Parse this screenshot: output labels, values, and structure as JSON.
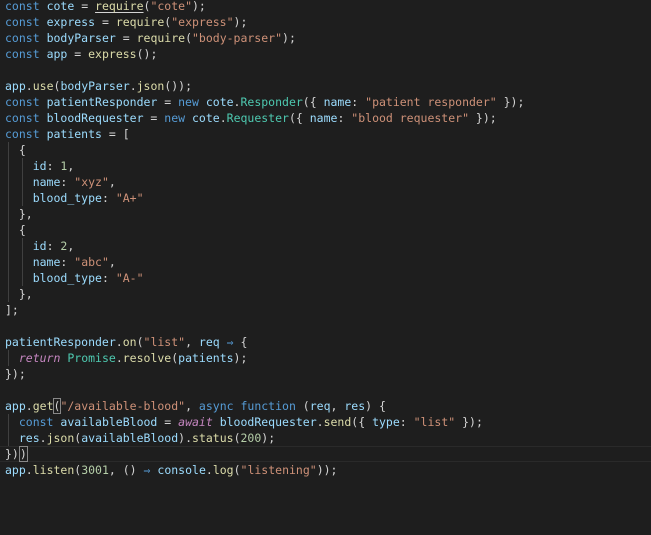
{
  "editor": {
    "language": "javascript",
    "theme": {
      "background": "#1e1e1e",
      "foreground": "#d4d4d4",
      "keyword": "#569cd6",
      "variable": "#9cdcfe",
      "function": "#dcdcaa",
      "string": "#ce9178",
      "number": "#b5cea8",
      "class": "#4ec9b0",
      "control": "#c586c0"
    },
    "lines": [
      [
        [
          "kw",
          "const"
        ],
        [
          "p",
          " "
        ],
        [
          "var",
          "cote"
        ],
        [
          "p",
          " = "
        ],
        [
          "fnu",
          "require"
        ],
        [
          "p",
          "("
        ],
        [
          "str",
          "\"cote\""
        ],
        [
          "p",
          ");"
        ]
      ],
      [
        [
          "kw",
          "const"
        ],
        [
          "p",
          " "
        ],
        [
          "var",
          "express"
        ],
        [
          "p",
          " = "
        ],
        [
          "fn",
          "require"
        ],
        [
          "p",
          "("
        ],
        [
          "str",
          "\"express\""
        ],
        [
          "p",
          ");"
        ]
      ],
      [
        [
          "kw",
          "const"
        ],
        [
          "p",
          " "
        ],
        [
          "var",
          "bodyParser"
        ],
        [
          "p",
          " = "
        ],
        [
          "fn",
          "require"
        ],
        [
          "p",
          "("
        ],
        [
          "str",
          "\"body-parser\""
        ],
        [
          "p",
          ");"
        ]
      ],
      [
        [
          "kw",
          "const"
        ],
        [
          "p",
          " "
        ],
        [
          "var",
          "app"
        ],
        [
          "p",
          " = "
        ],
        [
          "fn",
          "express"
        ],
        [
          "p",
          "();"
        ]
      ],
      [],
      [
        [
          "var",
          "app"
        ],
        [
          "p",
          "."
        ],
        [
          "fn",
          "use"
        ],
        [
          "p",
          "("
        ],
        [
          "var",
          "bodyParser"
        ],
        [
          "p",
          "."
        ],
        [
          "fn",
          "json"
        ],
        [
          "p",
          "());"
        ]
      ],
      [
        [
          "kw",
          "const"
        ],
        [
          "p",
          " "
        ],
        [
          "var",
          "patientResponder"
        ],
        [
          "p",
          " = "
        ],
        [
          "kw",
          "new"
        ],
        [
          "p",
          " "
        ],
        [
          "var",
          "cote"
        ],
        [
          "p",
          "."
        ],
        [
          "cls",
          "Responder"
        ],
        [
          "p",
          "({ "
        ],
        [
          "var",
          "name"
        ],
        [
          "p",
          ": "
        ],
        [
          "str",
          "\"patient responder\""
        ],
        [
          "p",
          " });"
        ]
      ],
      [
        [
          "kw",
          "const"
        ],
        [
          "p",
          " "
        ],
        [
          "var",
          "bloodRequester"
        ],
        [
          "p",
          " = "
        ],
        [
          "kw",
          "new"
        ],
        [
          "p",
          " "
        ],
        [
          "var",
          "cote"
        ],
        [
          "p",
          "."
        ],
        [
          "cls",
          "Requester"
        ],
        [
          "p",
          "({ "
        ],
        [
          "var",
          "name"
        ],
        [
          "p",
          ": "
        ],
        [
          "str",
          "\"blood requester\""
        ],
        [
          "p",
          " });"
        ]
      ],
      [
        [
          "kw",
          "const"
        ],
        [
          "p",
          " "
        ],
        [
          "var",
          "patients"
        ],
        [
          "p",
          " = ["
        ]
      ],
      [
        [
          "p",
          "  {"
        ]
      ],
      [
        [
          "p",
          "    "
        ],
        [
          "var",
          "id"
        ],
        [
          "p",
          ": "
        ],
        [
          "num",
          "1"
        ],
        [
          "p",
          ","
        ]
      ],
      [
        [
          "p",
          "    "
        ],
        [
          "var",
          "name"
        ],
        [
          "p",
          ": "
        ],
        [
          "str",
          "\"xyz\""
        ],
        [
          "p",
          ","
        ]
      ],
      [
        [
          "p",
          "    "
        ],
        [
          "var",
          "blood_type"
        ],
        [
          "p",
          ": "
        ],
        [
          "str",
          "\"A+\""
        ]
      ],
      [
        [
          "p",
          "  },"
        ]
      ],
      [
        [
          "p",
          "  {"
        ]
      ],
      [
        [
          "p",
          "    "
        ],
        [
          "var",
          "id"
        ],
        [
          "p",
          ": "
        ],
        [
          "num",
          "2"
        ],
        [
          "p",
          ","
        ]
      ],
      [
        [
          "p",
          "    "
        ],
        [
          "var",
          "name"
        ],
        [
          "p",
          ": "
        ],
        [
          "str",
          "\"abc\""
        ],
        [
          "p",
          ","
        ]
      ],
      [
        [
          "p",
          "    "
        ],
        [
          "var",
          "blood_type"
        ],
        [
          "p",
          ": "
        ],
        [
          "str",
          "\"A-\""
        ]
      ],
      [
        [
          "p",
          "  },"
        ]
      ],
      [
        [
          "p",
          "];"
        ]
      ],
      [],
      [
        [
          "var",
          "patientResponder"
        ],
        [
          "p",
          "."
        ],
        [
          "fn",
          "on"
        ],
        [
          "p",
          "("
        ],
        [
          "str",
          "\"list\""
        ],
        [
          "p",
          ", "
        ],
        [
          "var",
          "req"
        ],
        [
          "p",
          " "
        ],
        [
          "kw",
          "⇒"
        ],
        [
          "p",
          " {"
        ]
      ],
      [
        [
          "p",
          "  "
        ],
        [
          "ctl",
          "return"
        ],
        [
          "p",
          " "
        ],
        [
          "cls",
          "Promise"
        ],
        [
          "p",
          "."
        ],
        [
          "fn",
          "resolve"
        ],
        [
          "p",
          "("
        ],
        [
          "var",
          "patients"
        ],
        [
          "p",
          ");"
        ]
      ],
      [
        [
          "p",
          "});"
        ]
      ],
      [],
      [
        [
          "var",
          "app"
        ],
        [
          "p",
          "."
        ],
        [
          "fn",
          "get"
        ],
        [
          "pb",
          "("
        ],
        [
          "str",
          "\"/available-blood\""
        ],
        [
          "p",
          ", "
        ],
        [
          "kw",
          "async"
        ],
        [
          "p",
          " "
        ],
        [
          "kw",
          "function"
        ],
        [
          "p",
          " ("
        ],
        [
          "var",
          "req"
        ],
        [
          "p",
          ", "
        ],
        [
          "var",
          "res"
        ],
        [
          "p",
          ") {"
        ]
      ],
      [
        [
          "p",
          "  "
        ],
        [
          "kw",
          "const"
        ],
        [
          "p",
          " "
        ],
        [
          "var",
          "availableBlood"
        ],
        [
          "p",
          " = "
        ],
        [
          "ctl",
          "await"
        ],
        [
          "p",
          " "
        ],
        [
          "var",
          "bloodRequester"
        ],
        [
          "p",
          "."
        ],
        [
          "fn",
          "send"
        ],
        [
          "p",
          "({ "
        ],
        [
          "var",
          "type"
        ],
        [
          "p",
          ": "
        ],
        [
          "str",
          "\"list\""
        ],
        [
          "p",
          " });"
        ]
      ],
      [
        [
          "p",
          "  "
        ],
        [
          "var",
          "res"
        ],
        [
          "p",
          "."
        ],
        [
          "fn",
          "json"
        ],
        [
          "p",
          "("
        ],
        [
          "var",
          "availableBlood"
        ],
        [
          "p",
          ")."
        ],
        [
          "fn",
          "status"
        ],
        [
          "p",
          "("
        ],
        [
          "num",
          "200"
        ],
        [
          "p",
          ");"
        ]
      ],
      [
        [
          "p",
          "})"
        ],
        [
          "cur",
          ""
        ],
        [
          "pb",
          ")"
        ]
      ],
      [
        [
          "var",
          "app"
        ],
        [
          "p",
          "."
        ],
        [
          "fn",
          "listen"
        ],
        [
          "p",
          "("
        ],
        [
          "num",
          "3001"
        ],
        [
          "p",
          ", () "
        ],
        [
          "kw",
          "⇒"
        ],
        [
          "p",
          " "
        ],
        [
          "var",
          "console"
        ],
        [
          "p",
          "."
        ],
        [
          "fn",
          "log"
        ],
        [
          "p",
          "("
        ],
        [
          "str",
          "\"listening\""
        ],
        [
          "p",
          "));"
        ]
      ]
    ]
  }
}
